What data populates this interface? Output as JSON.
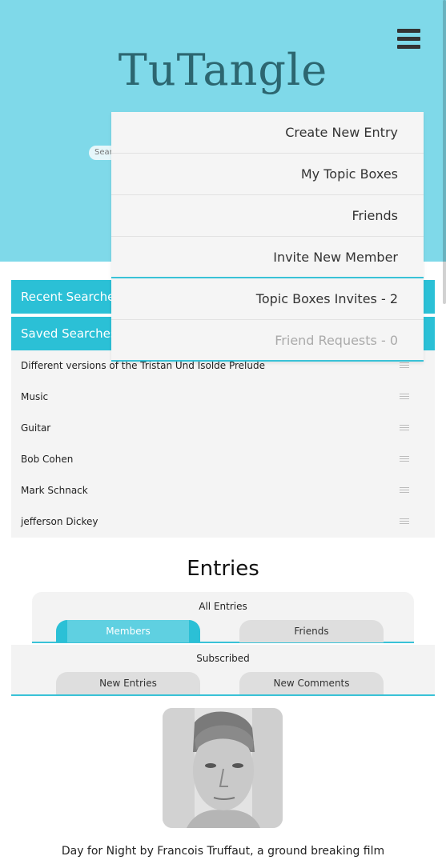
{
  "header": {
    "logo": "TuTangle",
    "search_placeholder": "Sear"
  },
  "menu": {
    "items": [
      "Create New Entry",
      "My Topic Boxes",
      "Friends",
      "Invite New Member",
      "Topic Boxes Invites - 2",
      "Friend Requests - 0"
    ]
  },
  "accordions": {
    "recent": {
      "label": "Recent Searches",
      "chevron": "chevron-down-icon"
    },
    "saved": {
      "label": "Saved Searches",
      "chevron": "chevron-down-icon"
    }
  },
  "saved_searches": [
    "Different versions of the Tristan Und Isolde Prelude",
    "Music",
    "Guitar",
    "Bob Cohen",
    "Mark Schnack",
    "jefferson Dickey"
  ],
  "entries": {
    "title": "Entries",
    "all_label": "All Entries",
    "tabs": [
      "Members",
      "Friends"
    ],
    "subscribed_label": "Subscribed",
    "subtabs": [
      "New Entries",
      "New Comments"
    ]
  },
  "entry": {
    "caption": "Day for Night by Francois Truffaut, a ground breaking film"
  },
  "colors": {
    "hero": "#7fd9e9",
    "accent": "#2bc0d6",
    "logo": "#2c6670"
  }
}
